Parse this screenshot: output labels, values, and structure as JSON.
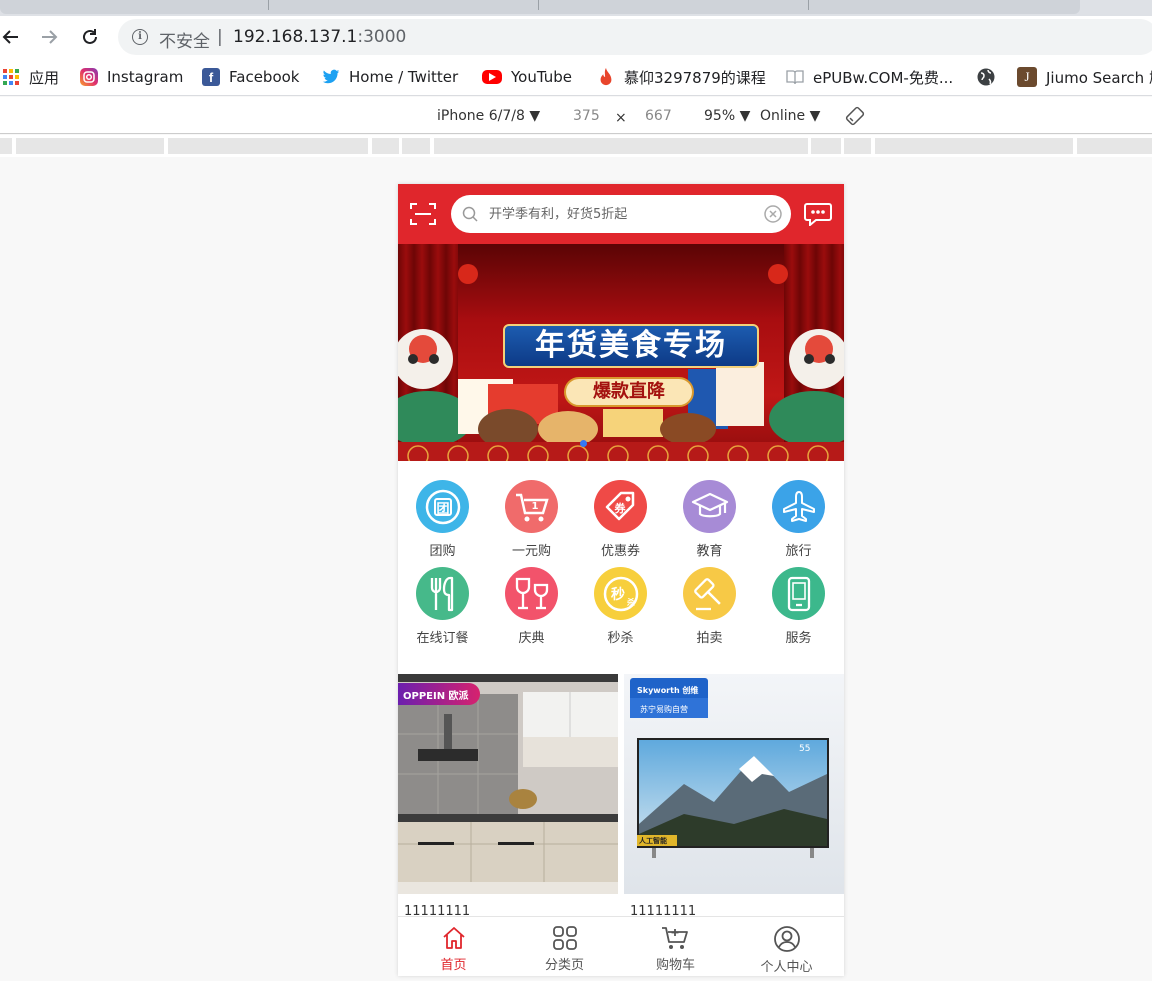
{
  "browser": {
    "address": {
      "security_label": "不安全",
      "separator": "|",
      "host": "192.168.137.1",
      "port": ":3000"
    },
    "bookmarks": [
      {
        "label": "应用",
        "icon": "apps-grid-icon"
      },
      {
        "label": "Instagram",
        "icon": "instagram-icon"
      },
      {
        "label": "Facebook",
        "icon": "facebook-icon"
      },
      {
        "label": "Home / Twitter",
        "icon": "twitter-icon"
      },
      {
        "label": "YouTube",
        "icon": "youtube-icon"
      },
      {
        "label": "慕仰3297879的课程",
        "icon": "flame-icon"
      },
      {
        "label": "ePUBw.COM-免费...",
        "icon": "book-icon"
      },
      {
        "label": "",
        "icon": "globe-icon"
      },
      {
        "label": "Jiumo Search 鸠",
        "icon": "jiumo-icon"
      }
    ]
  },
  "device_toolbar": {
    "device": "iPhone 6/7/8 ▼",
    "width": "375",
    "times": "×",
    "height": "667",
    "zoom": "95% ▼",
    "network": "Online ▼"
  },
  "app": {
    "colors": {
      "primary": "#e0262c"
    },
    "search": {
      "placeholder": "开学季有利，好货5折起"
    },
    "banner": {
      "title": "年货美食专场",
      "subtitle": "爆款直降"
    },
    "categories": [
      {
        "label": "团购",
        "color": "#3eb5e8",
        "icon": "group-buy-icon"
      },
      {
        "label": "一元购",
        "color": "#f06b6b",
        "icon": "cart-icon"
      },
      {
        "label": "优惠券",
        "color": "#ef4a47",
        "icon": "coupon-icon"
      },
      {
        "label": "教育",
        "color": "#a78bd6",
        "icon": "graduation-cap-icon"
      },
      {
        "label": "旅行",
        "color": "#3ba3e8",
        "icon": "airplane-icon"
      },
      {
        "label": "在线订餐",
        "color": "#46b98a",
        "icon": "cutlery-icon"
      },
      {
        "label": "庆典",
        "color": "#f2536b",
        "icon": "wine-glasses-icon"
      },
      {
        "label": "秒杀",
        "color": "#f7cf3c",
        "icon": "flash-sale-icon"
      },
      {
        "label": "拍卖",
        "color": "#f7c946",
        "icon": "auction-hammer-icon"
      },
      {
        "label": "服务",
        "color": "#3cb88c",
        "icon": "phone-service-icon"
      }
    ],
    "products": [
      {
        "name": "11111111",
        "brand_badge": "OPPEIN 欧派"
      },
      {
        "name": "11111111",
        "brand_badge": "Skyworth 创维",
        "store_badge": "苏宁易购自营",
        "tv_size": "55",
        "tv_tag": "人工智能"
      }
    ],
    "tabs": [
      {
        "label": "首页",
        "active": true
      },
      {
        "label": "分类页",
        "active": false
      },
      {
        "label": "购物车",
        "active": false
      },
      {
        "label": "个人中心",
        "active": false
      }
    ]
  }
}
